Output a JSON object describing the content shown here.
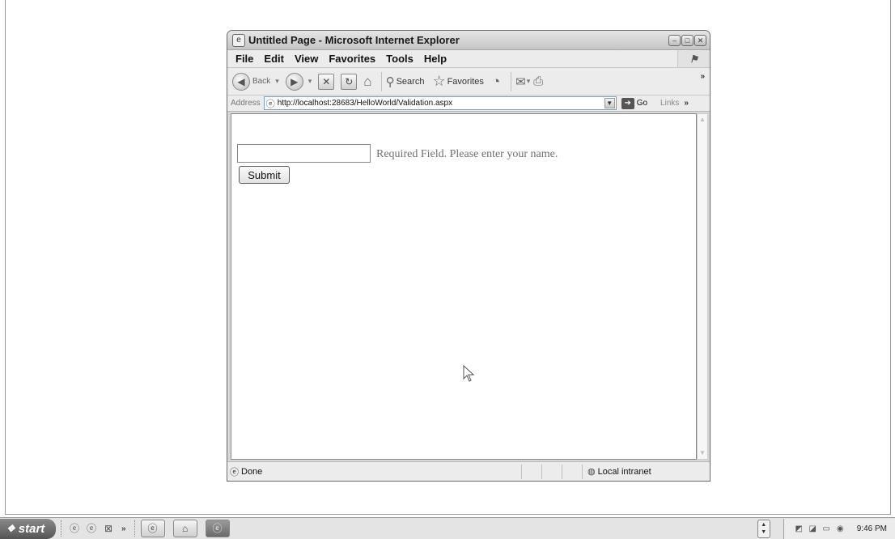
{
  "window": {
    "title": "Untitled Page - Microsoft Internet Explorer",
    "controls": {
      "minimize": "–",
      "maximize": "□",
      "close": "✕"
    }
  },
  "menu": [
    "File",
    "Edit",
    "View",
    "Favorites",
    "Tools",
    "Help"
  ],
  "toolbar": {
    "back_label": "Back",
    "search_label": "Search",
    "favorites_label": "Favorites",
    "more": "»"
  },
  "address": {
    "label": "Address",
    "url": "http://localhost:28683/HelloWorld/Validation.aspx",
    "go_label": "Go",
    "links_label": "Links",
    "links_more": "»"
  },
  "page": {
    "name_input_value": "",
    "validator_message": "Required Field. Please enter your name.",
    "submit_label": "Submit"
  },
  "status": {
    "text": "Done",
    "zone": "Local intranet"
  },
  "taskbar": {
    "start_label": "start",
    "quick_launch_more": "»",
    "clock": "9:46 PM"
  },
  "icons": {
    "ie": "ie-page-icon",
    "back": "back-arrow-icon",
    "forward": "forward-arrow-icon",
    "stop": "stop-icon",
    "refresh": "refresh-icon",
    "home": "home-icon",
    "search": "search-icon",
    "favorites": "favorites-star-icon",
    "history": "history-icon",
    "mail": "mail-icon",
    "print": "print-icon"
  }
}
